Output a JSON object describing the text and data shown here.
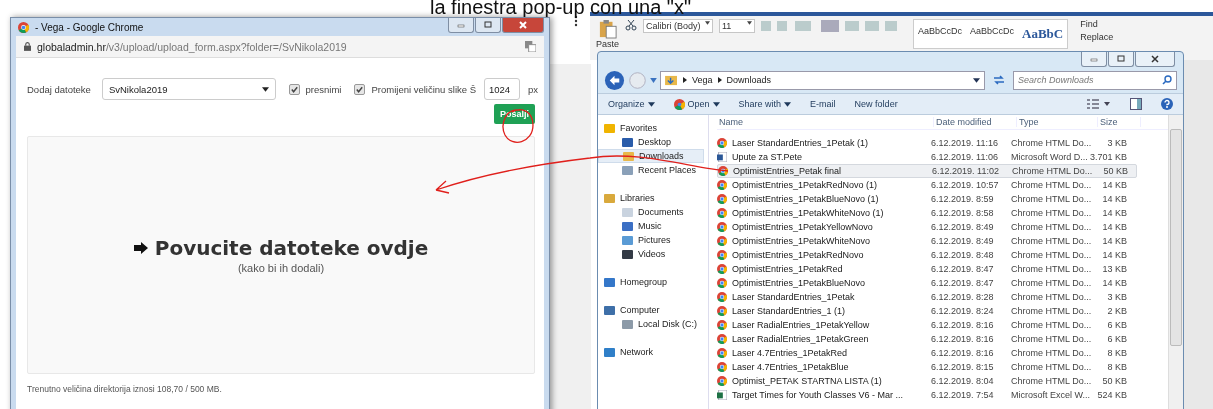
{
  "caption": "la finestra pop-up con una \"x\"",
  "browser": {
    "title": "- Vega - Google Chrome",
    "url_domain": "globaladmin.hr",
    "url_path": "/v3/upload/upload_form.aspx?folder=/SvNikola2019",
    "form": {
      "label": "Dodaj datoteke",
      "folder": "SvNikola2019",
      "options": [
        {
          "label": "presnimi",
          "checked": true
        },
        {
          "label": "Promijeni veličinu slike Š",
          "checked": true
        }
      ],
      "width_value": "1024",
      "unit": "px",
      "submit": "Pošalji"
    },
    "dropzone": {
      "title": "Povucite datoteke ovdje",
      "subtitle": "(kako bi ih dodali)"
    },
    "footer": "Trenutno veličina direktorija iznosi 108,70 / 500 MB."
  },
  "word_ribbon": {
    "paste": "Paste",
    "font": "Calibri (Body)",
    "size": "11",
    "styles": [
      "AaBbCcDc",
      "AaBbCcDc",
      "AaBbC"
    ],
    "find": "Find",
    "replace": "Replace"
  },
  "explorer": {
    "breadcrumb": [
      "Vega",
      "Downloads"
    ],
    "search_placeholder": "Search Downloads",
    "toolbar": [
      {
        "label": "Organize",
        "kind": "menu"
      },
      {
        "label": "Open",
        "kind": "chrome"
      },
      {
        "label": "Share with",
        "kind": "menu"
      },
      {
        "label": "E-mail",
        "kind": "plain"
      },
      {
        "label": "New folder",
        "kind": "plain"
      }
    ],
    "nav": [
      {
        "label": "Favorites",
        "kind": "star",
        "children": [
          {
            "label": "Desktop",
            "kind": "monitor",
            "selected": false
          },
          {
            "label": "Downloads",
            "kind": "folder",
            "selected": true
          },
          {
            "label": "Recent Places",
            "kind": "recent",
            "selected": false
          }
        ]
      },
      {
        "label": "Libraries",
        "kind": "library",
        "children": [
          {
            "label": "Documents",
            "kind": "document",
            "selected": false
          },
          {
            "label": "Music",
            "kind": "music",
            "selected": false
          },
          {
            "label": "Pictures",
            "kind": "pictures",
            "selected": false
          },
          {
            "label": "Videos",
            "kind": "video",
            "selected": false
          }
        ]
      },
      {
        "label": "Homegroup",
        "kind": "homegroup"
      },
      {
        "label": "Computer",
        "kind": "computer",
        "children": [
          {
            "label": "Local Disk (C:)",
            "kind": "disk",
            "selected": false
          }
        ]
      },
      {
        "label": "Network",
        "kind": "network"
      }
    ],
    "columns": [
      "Name",
      "Date modified",
      "Type",
      "Size"
    ],
    "files": [
      {
        "name": "Laser StandardEntries_1Petak (1)",
        "kind": "chrome",
        "date": "6.12.2019. 11:16",
        "type": "Chrome HTML Do...",
        "size": "3 KB",
        "selected": false
      },
      {
        "name": "Upute za ST.Pete",
        "kind": "word",
        "date": "6.12.2019. 11:06",
        "type": "Microsoft Word D...",
        "size": "3.701 KB",
        "selected": false
      },
      {
        "name": "OptimistEntries_Petak final",
        "kind": "chrome",
        "date": "6.12.2019. 11:02",
        "type": "Chrome HTML Do...",
        "size": "50 KB",
        "selected": true
      },
      {
        "name": "OptimistEntries_1PetakRedNovo (1)",
        "kind": "chrome",
        "date": "6.12.2019. 10:57",
        "type": "Chrome HTML Do...",
        "size": "14 KB",
        "selected": false
      },
      {
        "name": "OptimistEntries_1PetakBlueNovo (1)",
        "kind": "chrome",
        "date": "6.12.2019. 8:59",
        "type": "Chrome HTML Do...",
        "size": "14 KB",
        "selected": false
      },
      {
        "name": "OptimistEntries_1PetakWhiteNovo (1)",
        "kind": "chrome",
        "date": "6.12.2019. 8:58",
        "type": "Chrome HTML Do...",
        "size": "14 KB",
        "selected": false
      },
      {
        "name": "OptimistEntries_1PetakYellowNovo",
        "kind": "chrome",
        "date": "6.12.2019. 8:49",
        "type": "Chrome HTML Do...",
        "size": "14 KB",
        "selected": false
      },
      {
        "name": "OptimistEntries_1PetakWhiteNovo",
        "kind": "chrome",
        "date": "6.12.2019. 8:49",
        "type": "Chrome HTML Do...",
        "size": "14 KB",
        "selected": false
      },
      {
        "name": "OptimistEntries_1PetakRedNovo",
        "kind": "chrome",
        "date": "6.12.2019. 8:48",
        "type": "Chrome HTML Do...",
        "size": "14 KB",
        "selected": false
      },
      {
        "name": "OptimistEntries_1PetakRed",
        "kind": "chrome",
        "date": "6.12.2019. 8:47",
        "type": "Chrome HTML Do...",
        "size": "13 KB",
        "selected": false
      },
      {
        "name": "OptimistEntries_1PetakBlueNovo",
        "kind": "chrome",
        "date": "6.12.2019. 8:47",
        "type": "Chrome HTML Do...",
        "size": "14 KB",
        "selected": false
      },
      {
        "name": "Laser StandardEntries_1Petak",
        "kind": "chrome",
        "date": "6.12.2019. 8:28",
        "type": "Chrome HTML Do...",
        "size": "3 KB",
        "selected": false
      },
      {
        "name": "Laser StandardEntries_1 (1)",
        "kind": "chrome",
        "date": "6.12.2019. 8:24",
        "type": "Chrome HTML Do...",
        "size": "2 KB",
        "selected": false
      },
      {
        "name": "Laser RadialEntries_1PetakYellow",
        "kind": "chrome",
        "date": "6.12.2019. 8:16",
        "type": "Chrome HTML Do...",
        "size": "6 KB",
        "selected": false
      },
      {
        "name": "Laser RadialEntries_1PetakGreen",
        "kind": "chrome",
        "date": "6.12.2019. 8:16",
        "type": "Chrome HTML Do...",
        "size": "6 KB",
        "selected": false
      },
      {
        "name": "Laser 4.7Entries_1PetakRed",
        "kind": "chrome",
        "date": "6.12.2019. 8:16",
        "type": "Chrome HTML Do...",
        "size": "8 KB",
        "selected": false
      },
      {
        "name": "Laser 4.7Entries_1PetakBlue",
        "kind": "chrome",
        "date": "6.12.2019. 8:15",
        "type": "Chrome HTML Do...",
        "size": "8 KB",
        "selected": false
      },
      {
        "name": "Optimist_PETAK STARTNA LISTA (1)",
        "kind": "chrome",
        "date": "6.12.2019. 8:04",
        "type": "Chrome HTML Do...",
        "size": "50 KB",
        "selected": false
      },
      {
        "name": "Target Times for Youth Classes V6 - Mar ...",
        "kind": "excel",
        "date": "6.12.2019. 7:54",
        "type": "Microsoft Excel W...",
        "size": "524 KB",
        "selected": false
      }
    ]
  }
}
